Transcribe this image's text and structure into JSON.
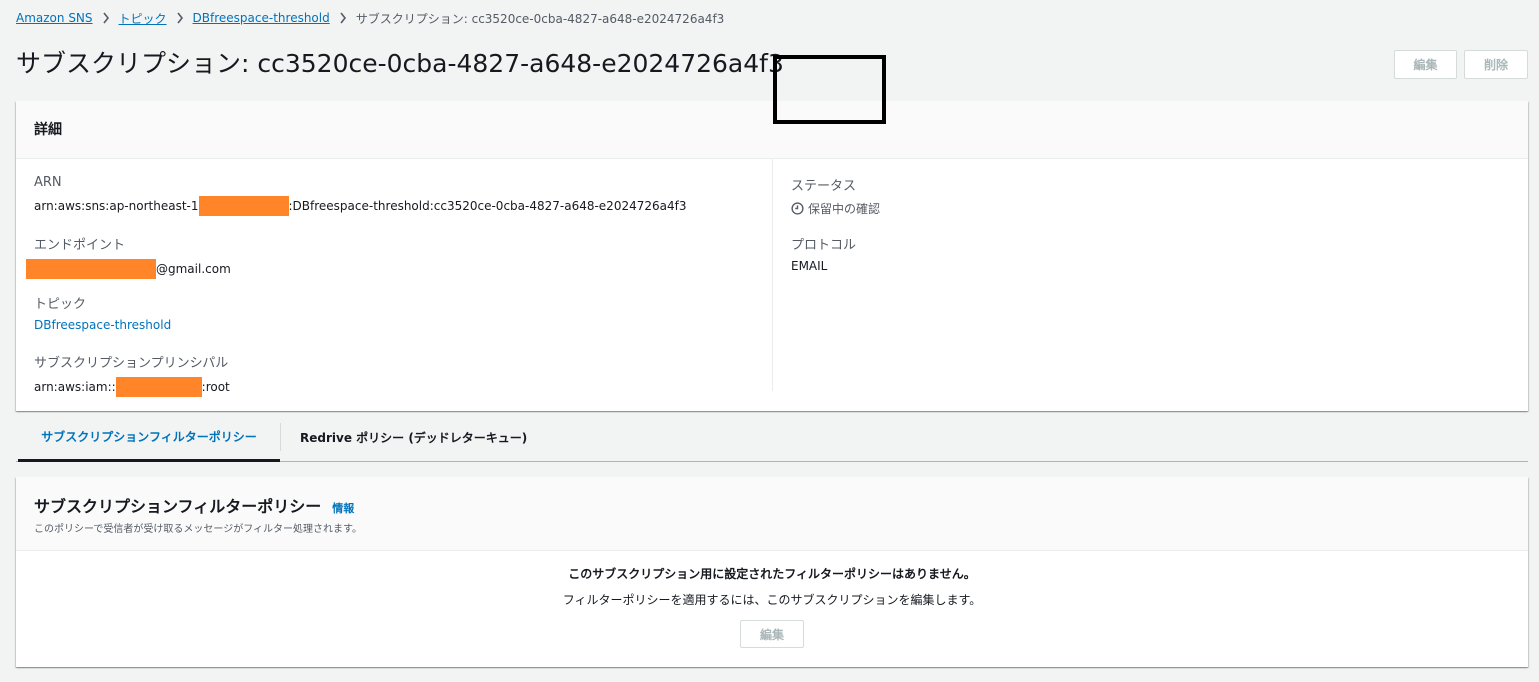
{
  "breadcrumb": {
    "items": [
      "Amazon SNS",
      "トピック",
      "DBfreespace-threshold"
    ],
    "current": "サブスクリプション: cc3520ce-0cba-4827-a648-e2024726a4f3"
  },
  "header": {
    "title": "サブスクリプション: cc3520ce-0cba-4827-a648-e2024726a4f3",
    "edit_label": "編集",
    "delete_label": "削除"
  },
  "details": {
    "title": "詳細",
    "arn": {
      "label": "ARN",
      "prefix": "arn:aws:sns:ap-northeast-1",
      "suffix": ":DBfreespace-threshold:cc3520ce-0cba-4827-a648-e2024726a4f3"
    },
    "endpoint": {
      "label": "エンドポイント",
      "suffix": "@gmail.com"
    },
    "topic": {
      "label": "トピック",
      "value": "DBfreespace-threshold"
    },
    "principal": {
      "label": "サブスクリプションプリンシパル",
      "prefix": "arn:aws:iam::",
      "suffix": ":root"
    },
    "status": {
      "label": "ステータス",
      "value": "保留中の確認"
    },
    "protocol": {
      "label": "プロトコル",
      "value": "EMAIL"
    }
  },
  "tabs": [
    {
      "label": "サブスクリプションフィルターポリシー",
      "active": true
    },
    {
      "label": "Redrive ポリシー (デッドレターキュー)",
      "active": false
    }
  ],
  "filter_policy": {
    "title": "サブスクリプションフィルターポリシー",
    "info_label": "情報",
    "description": "このポリシーで受信者が受け取るメッセージがフィルター処理されます。",
    "empty_title": "このサブスクリプション用に設定されたフィルターポリシーはありません。",
    "empty_sub": "フィルターポリシーを適用するには、このサブスクリプションを編集します。",
    "edit_label": "編集"
  },
  "colors": {
    "link": "#0073bb",
    "redaction": "#ff8528",
    "background": "#f2f3f3"
  }
}
